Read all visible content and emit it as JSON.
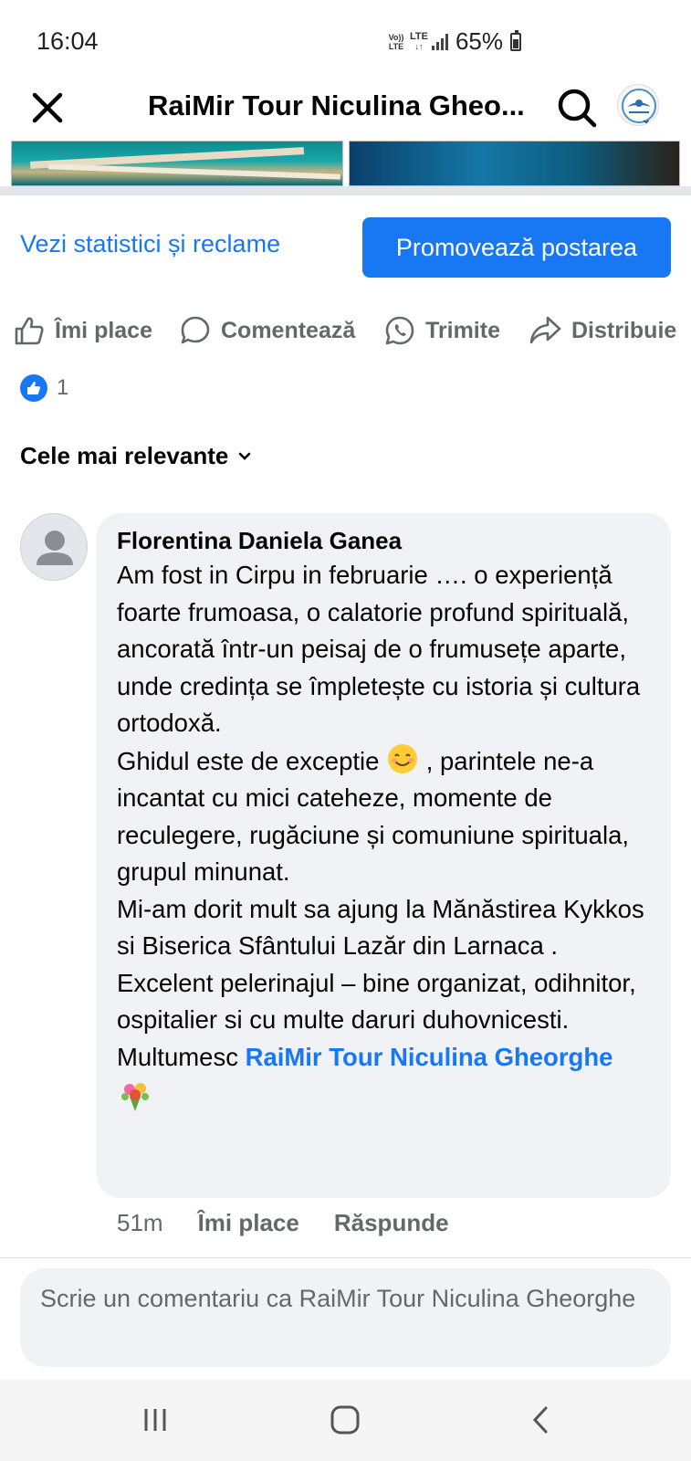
{
  "status_bar": {
    "time": "16:04",
    "network_volte": "Vo)) LTE",
    "network_lte": "LTE",
    "battery": "65%"
  },
  "header": {
    "title": "RaiMir Tour Niculina Gheo...",
    "close_icon": "close-icon",
    "search_icon": "search-icon"
  },
  "post_actions": {
    "stats_link": "Vezi statistici și reclame",
    "promote_button": "Promovează postarea",
    "like": "Îmi place",
    "comment": "Comentează",
    "send": "Trimite",
    "share": "Distribuie"
  },
  "reactions": {
    "like_count": "1"
  },
  "sort": {
    "label": "Cele mai relevante"
  },
  "comment": {
    "author": "Florentina Daniela Ganea",
    "p1": "Am fost in Cirpu  in februarie …. o experiență foarte frumoasa, o calatorie profund spirituală, ancorată într-un peisaj de o frumusețe aparte, unde credința se împletește cu istoria și cultura ortodoxă.",
    "p2_a": "Ghidul este de exceptie",
    "p2_b": ", parintele ne-a incantat cu mici cateheze, momente de reculegere, rugăciune și comuniune spirituala, grupul minunat.",
    "p3": "Mi-am dorit mult sa ajung la  Mănăstirea Kykkos  si Biserica Sfântului Lazăr din Larnaca .",
    "p4": "Excelent pelerinajul – bine organizat, odihnitor, ospitalier si cu multe daruri duhovnicesti. Multumesc",
    "tag": "RaiMir Tour Niculina Gheorghe",
    "time": "51m",
    "like_action": "Îmi place",
    "reply_action": "Răspunde"
  },
  "composer": {
    "placeholder": "Scrie un comentariu ca RaiMir Tour Niculina Gheorghe"
  },
  "colors": {
    "accent": "#1877f2",
    "bubble": "#f0f2f5",
    "muted_text": "#65676b"
  }
}
